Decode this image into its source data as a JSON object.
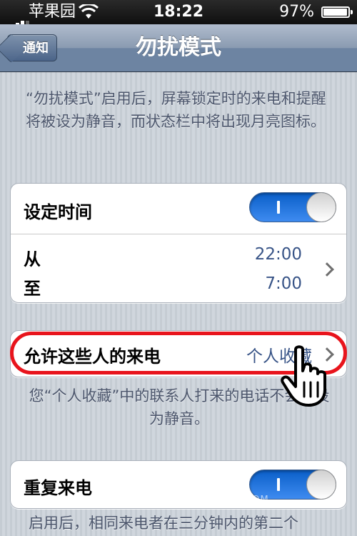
{
  "status_bar": {
    "carrier": "苹果园",
    "time": "18:22",
    "battery": "97%"
  },
  "nav": {
    "back_label": "通知",
    "title": "勿扰模式"
  },
  "intro_text": "“勿扰模式”启用后，屏幕锁定时的来电和提醒将被设为静音，而状态栏中将出现月亮图标。",
  "schedule": {
    "label": "设定时间",
    "enabled": true,
    "from_label": "从",
    "from_value": "22:00",
    "to_label": "至",
    "to_value": "7:00"
  },
  "allow_calls": {
    "label": "允许这些人的来电",
    "value": "个人收藏"
  },
  "allow_calls_note": "您“个人收藏”中的联系人打来的电话不会被设为静音。",
  "repeated_calls": {
    "label": "重复来电",
    "enabled": true
  },
  "repeated_calls_note": "启用后，相同来电者在三分钟内的第二个",
  "watermark": "三联网 3LIAN.COM",
  "colors": {
    "toggle_on": "#1a6fe0",
    "highlight": "#e8141c",
    "value_text": "#385487"
  }
}
